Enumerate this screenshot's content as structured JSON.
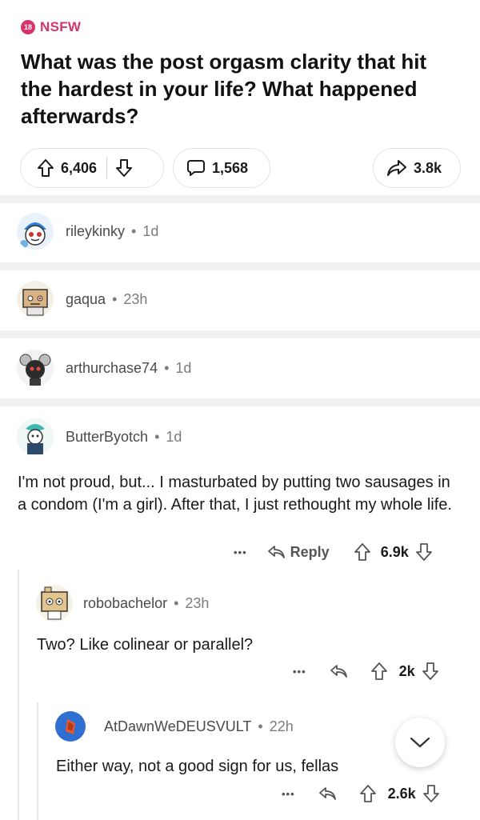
{
  "post": {
    "nsfw_badge": "18",
    "nsfw_label": "NSFW",
    "title": "What was the post orgasm clarity that hit the hardest in your life? What happened afterwards?",
    "score": "6,406",
    "comment_count": "1,568",
    "share_count": "3.8k"
  },
  "collapsed_comments": [
    {
      "username": "rileykinky",
      "age": "1d"
    },
    {
      "username": "gaqua",
      "age": "23h"
    },
    {
      "username": "arthurchase74",
      "age": "1d"
    }
  ],
  "comment": {
    "username": "ButterByotch",
    "age": "1d",
    "text": "I'm not proud, but... I masturbated by putting two sausages in a condom (I'm a girl). After that, I just rethought my whole life.",
    "more": "•••",
    "reply_label": "Reply",
    "score": "6.9k"
  },
  "reply1": {
    "username": "robobachelor",
    "age": "23h",
    "text": "Two? Like colinear or parallel?",
    "more": "•••",
    "score": "2k"
  },
  "reply2": {
    "username": "AtDawnWeDEUSVULT",
    "age": "22h",
    "text": "Either way, not a good sign for us, fellas",
    "more": "•••",
    "score": "2.6k"
  },
  "separator": "•",
  "icons": {
    "upvote": "upvote-arrow-icon",
    "downvote": "downvote-arrow-icon",
    "comment": "speech-bubble-icon",
    "share": "share-arrow-icon",
    "reply": "reply-arrow-icon",
    "scroll": "chevron-down-icon"
  },
  "colors": {
    "nsfw": "#d6336c",
    "text": "#1a1a1b",
    "muted": "#7c7c7c"
  }
}
